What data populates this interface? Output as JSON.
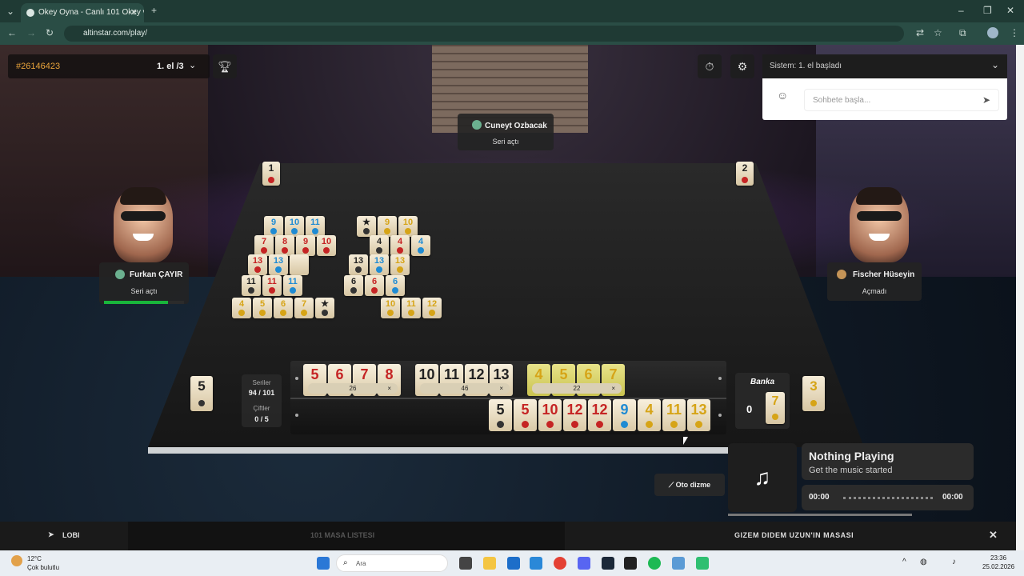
{
  "browser": {
    "tab_title": "Okey Oyna - Canlı 101 Okey ve",
    "url": "altinstar.com/play/"
  },
  "game": {
    "room_id": "#26146423",
    "round_label": "1. el /3",
    "chat": {
      "system_message": "Sistem: 1. el başladı",
      "input_placeholder": "Sohbete başla..."
    },
    "players": {
      "top": {
        "name": "Cuneyt Ozbacak",
        "status": "Seri açtı"
      },
      "left": {
        "name": "Furkan ÇAYIR",
        "status": "Seri açtı",
        "progress": 0.8
      },
      "right": {
        "name": "Fischer Hüseyin",
        "status": "Açmadı"
      }
    },
    "seat_numbers": {
      "left_top": "1",
      "right_top": "2",
      "left_indicator": "5",
      "right_indicator": "3"
    },
    "table_groups": [
      {
        "tiles": [
          {
            "n": "9",
            "c": "blue"
          },
          {
            "n": "10",
            "c": "blue"
          },
          {
            "n": "11",
            "c": "blue"
          }
        ]
      },
      {
        "tiles": [
          {
            "n": "7",
            "c": "red"
          },
          {
            "n": "8",
            "c": "red"
          },
          {
            "n": "9",
            "c": "red"
          },
          {
            "n": "10",
            "c": "red"
          }
        ]
      },
      {
        "tiles": [
          {
            "n": "13",
            "c": "red"
          },
          {
            "n": "13",
            "c": "blue"
          },
          {
            "n": "",
            "c": "blank"
          }
        ]
      },
      {
        "tiles": [
          {
            "n": "11",
            "c": "blk"
          },
          {
            "n": "11",
            "c": "red"
          },
          {
            "n": "11",
            "c": "blue"
          }
        ]
      },
      {
        "tiles": [
          {
            "n": "4",
            "c": "yel"
          },
          {
            "n": "5",
            "c": "yel"
          },
          {
            "n": "6",
            "c": "yel"
          },
          {
            "n": "7",
            "c": "yel"
          },
          {
            "n": "★",
            "c": "blk"
          }
        ]
      },
      {
        "tiles": [
          {
            "n": "★",
            "c": "blk"
          },
          {
            "n": "9",
            "c": "yel"
          },
          {
            "n": "10",
            "c": "yel"
          }
        ]
      },
      {
        "tiles": [
          {
            "n": "4",
            "c": "blk"
          },
          {
            "n": "4",
            "c": "red"
          },
          {
            "n": "4",
            "c": "blue"
          }
        ]
      },
      {
        "tiles": [
          {
            "n": "13",
            "c": "blk"
          },
          {
            "n": "13",
            "c": "blue"
          },
          {
            "n": "13",
            "c": "yel"
          }
        ]
      },
      {
        "tiles": [
          {
            "n": "6",
            "c": "blk"
          },
          {
            "n": "6",
            "c": "red"
          },
          {
            "n": "6",
            "c": "blue"
          }
        ]
      },
      {
        "tiles": [
          {
            "n": "10",
            "c": "yel"
          },
          {
            "n": "11",
            "c": "yel"
          },
          {
            "n": "12",
            "c": "yel"
          }
        ]
      }
    ],
    "rack": {
      "top_groups": [
        {
          "tiles": [
            {
              "n": "5",
              "c": "red"
            },
            {
              "n": "6",
              "c": "red"
            },
            {
              "n": "7",
              "c": "red"
            },
            {
              "n": "8",
              "c": "red"
            }
          ],
          "sum": "26"
        },
        {
          "tiles": [
            {
              "n": "10",
              "c": "blk"
            },
            {
              "n": "11",
              "c": "blk"
            },
            {
              "n": "12",
              "c": "blk"
            },
            {
              "n": "13",
              "c": "blk"
            }
          ],
          "sum": "46"
        },
        {
          "tiles": [
            {
              "n": "4",
              "c": "yel"
            },
            {
              "n": "5",
              "c": "yel"
            },
            {
              "n": "6",
              "c": "yel"
            },
            {
              "n": "7",
              "c": "yel"
            }
          ],
          "sum": "22"
        }
      ],
      "bottom_tiles": [
        {
          "n": "5",
          "c": "blk"
        },
        {
          "n": "5",
          "c": "red"
        },
        {
          "n": "10",
          "c": "red"
        },
        {
          "n": "12",
          "c": "red"
        },
        {
          "n": "12",
          "c": "red"
        },
        {
          "n": "9",
          "c": "blue"
        },
        {
          "n": "4",
          "c": "yel"
        },
        {
          "n": "11",
          "c": "yel"
        },
        {
          "n": "13",
          "c": "yel"
        }
      ]
    },
    "series_box": {
      "label": "Seriler",
      "value": "94 / 101",
      "pairs_label": "Çiftler",
      "pairs_value": "0 / 5"
    },
    "bank": {
      "label": "Banka",
      "count": "0",
      "tile": {
        "n": "7",
        "c": "yel"
      }
    },
    "auto_sort_label": "Oto dizme",
    "bottom": {
      "lobby": "LOBI",
      "tables": "101 MASA LISTESI",
      "room_title": "GIZEM DIDEM UZUN'IN MASASI"
    },
    "music": {
      "title": "Nothing Playing",
      "subtitle": "Get the music started",
      "time_start": "00:00",
      "time_end": "00:00"
    }
  },
  "taskbar": {
    "weather_temp": "12°C",
    "weather_desc": "Çok bulutlu",
    "search_placeholder": "Ara",
    "time": "23:36",
    "date": "25.02.2026"
  }
}
